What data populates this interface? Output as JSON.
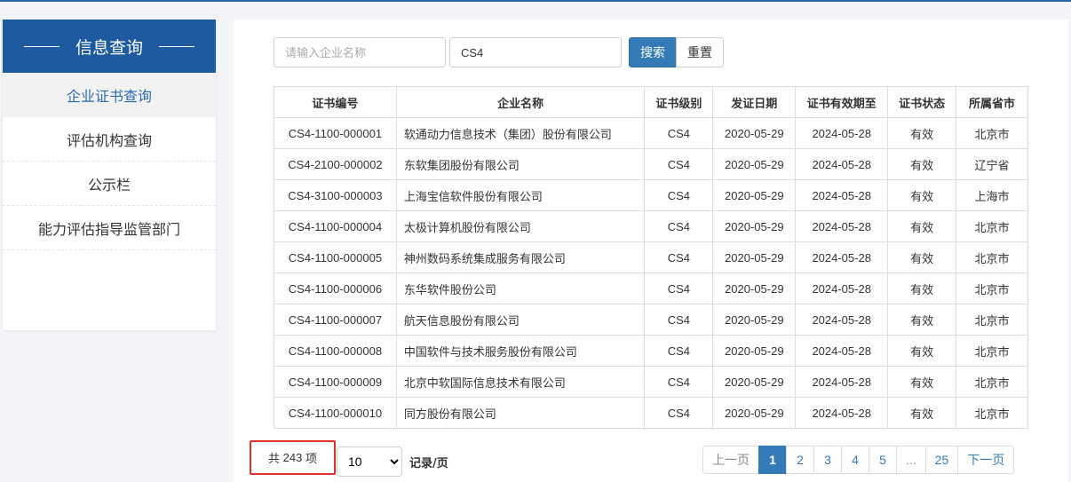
{
  "sidebar": {
    "title": "信息查询",
    "items": [
      {
        "label": "企业证书查询",
        "active": true
      },
      {
        "label": "评估机构查询"
      },
      {
        "label": "公示栏"
      },
      {
        "label": "能力评估指导监管部门"
      }
    ]
  },
  "search": {
    "company_placeholder": "请输入企业名称",
    "level_value": "CS4",
    "search_label": "搜索",
    "reset_label": "重置"
  },
  "table": {
    "headers": [
      "证书编号",
      "企业名称",
      "证书级别",
      "发证日期",
      "证书有效期至",
      "证书状态",
      "所属省市"
    ],
    "rows": [
      [
        "CS4-1100-000001",
        "软通动力信息技术（集团）股份有限公司",
        "CS4",
        "2020-05-29",
        "2024-05-28",
        "有效",
        "北京市"
      ],
      [
        "CS4-2100-000002",
        "东软集团股份有限公司",
        "CS4",
        "2020-05-29",
        "2024-05-28",
        "有效",
        "辽宁省"
      ],
      [
        "CS4-3100-000003",
        "上海宝信软件股份有限公司",
        "CS4",
        "2020-05-29",
        "2024-05-28",
        "有效",
        "上海市"
      ],
      [
        "CS4-1100-000004",
        "太极计算机股份有限公司",
        "CS4",
        "2020-05-29",
        "2024-05-28",
        "有效",
        "北京市"
      ],
      [
        "CS4-1100-000005",
        "神州数码系统集成服务有限公司",
        "CS4",
        "2020-05-29",
        "2024-05-28",
        "有效",
        "北京市"
      ],
      [
        "CS4-1100-000006",
        "东华软件股份公司",
        "CS4",
        "2020-05-29",
        "2024-05-28",
        "有效",
        "北京市"
      ],
      [
        "CS4-1100-000007",
        "航天信息股份有限公司",
        "CS4",
        "2020-05-29",
        "2024-05-28",
        "有效",
        "北京市"
      ],
      [
        "CS4-1100-000008",
        "中国软件与技术服务股份有限公司",
        "CS4",
        "2020-05-29",
        "2024-05-28",
        "有效",
        "北京市"
      ],
      [
        "CS4-1100-000009",
        "北京中软国际信息技术有限公司",
        "CS4",
        "2020-05-29",
        "2024-05-28",
        "有效",
        "北京市"
      ],
      [
        "CS4-1100-000010",
        "同方股份有限公司",
        "CS4",
        "2020-05-29",
        "2024-05-28",
        "有效",
        "北京市"
      ]
    ]
  },
  "footer": {
    "total_prefix": "共",
    "total_count": "243",
    "total_suffix": "项",
    "page_size": "10",
    "per_page_label": "记录/页"
  },
  "pagination": {
    "prev": "上一页",
    "pages": [
      "1",
      "2",
      "3",
      "4",
      "5",
      "...",
      "25"
    ],
    "current": "1",
    "next": "下一页"
  },
  "colors": {
    "primary": "#337ab7",
    "sidebar_header": "#1e5aa0",
    "highlight_border": "#e0302a"
  }
}
